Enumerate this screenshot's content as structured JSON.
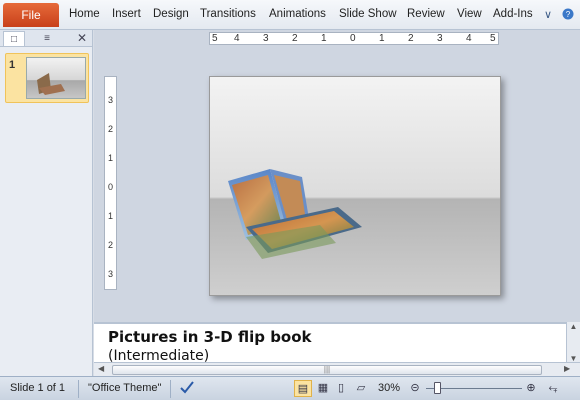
{
  "ribbon": {
    "file": "File",
    "tabs": [
      "Home",
      "Insert",
      "Design",
      "Transitions",
      "Animations",
      "Slide Show",
      "Review",
      "View",
      "Add-Ins"
    ],
    "help_icon": "help-icon",
    "minimize_icon": "chevron-icon"
  },
  "thumbnails": {
    "slide_number": "1"
  },
  "ruler": {
    "horizontal": [
      "5",
      "4",
      "3",
      "2",
      "1",
      "0",
      "1",
      "2",
      "3",
      "4",
      "5"
    ],
    "vertical": [
      "3",
      "2",
      "1",
      "0",
      "1",
      "2",
      "3"
    ]
  },
  "notes": {
    "title": "Pictures in 3-D flip book",
    "subtitle": "(Intermediate)"
  },
  "status": {
    "slide": "Slide 1 of 1",
    "theme": "\"Office Theme\"",
    "zoom": "30%",
    "zoom_level": 0.3
  },
  "colors": {
    "file_tab": "#d9532a",
    "accent": "#3b5a86",
    "active_view": "#fbe3a1"
  }
}
